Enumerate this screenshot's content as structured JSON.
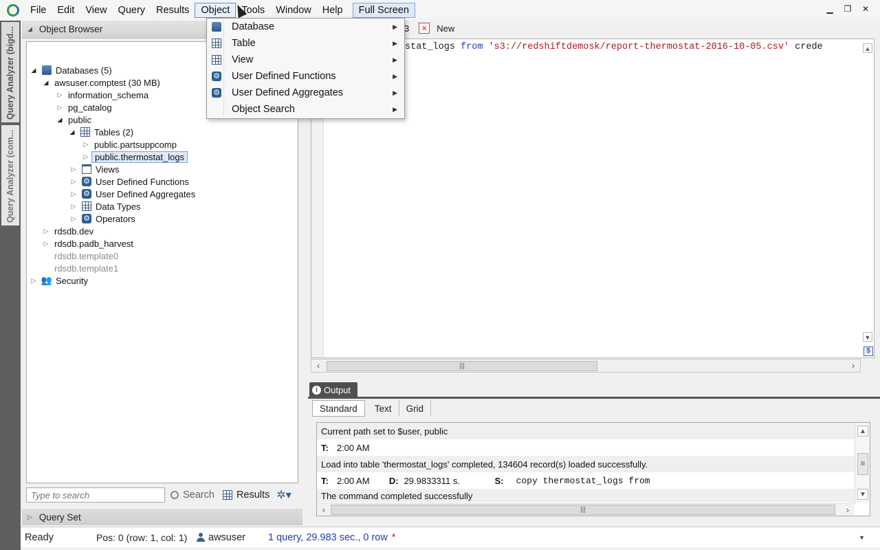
{
  "menubar": {
    "items": [
      "File",
      "Edit",
      "View",
      "Query",
      "Results",
      "Object",
      "Tools",
      "Window",
      "Help"
    ],
    "fullscreen_label": "Full Screen",
    "active_item": "Object"
  },
  "vertical_tabs": [
    "Query Analyzer (bigd...",
    "Query Analyzer (com..."
  ],
  "object_browser": {
    "title": "Object Browser",
    "tree": [
      {
        "label": "Databases (5)",
        "icon": "database-icon",
        "expanded": true
      },
      {
        "label": "awsuser.comptest (30 MB)",
        "expanded": true
      },
      {
        "label": "information_schema"
      },
      {
        "label": "pg_catalog"
      },
      {
        "label": "public",
        "expanded": true
      },
      {
        "label": "Tables (2)",
        "icon": "table-icon",
        "expanded": true
      },
      {
        "label": "public.partsuppcomp"
      },
      {
        "label": "public.thermostat_logs",
        "selected": true
      },
      {
        "label": "Views",
        "icon": "view-icon"
      },
      {
        "label": "User Defined Functions",
        "icon": "gear-icon"
      },
      {
        "label": "User Defined Aggregates",
        "icon": "gear-icon"
      },
      {
        "label": "Data Types",
        "icon": "table-icon"
      },
      {
        "label": "Operators",
        "icon": "gear-icon"
      },
      {
        "label": "rdsdb.dev"
      },
      {
        "label": "rdsdb.padb_harvest"
      },
      {
        "label": "rdsdb.template0"
      },
      {
        "label": "rdsdb.template1"
      },
      {
        "label": "Security",
        "icon": "users-icon"
      }
    ],
    "search_placeholder": "Type to search",
    "search_label": "Search",
    "results_label": "Results"
  },
  "query_set": {
    "title": "Query Set"
  },
  "object_menu": {
    "items": [
      {
        "label": "Database",
        "icon": "database-icon"
      },
      {
        "label": "Table",
        "icon": "table-icon"
      },
      {
        "label": "View",
        "icon": "view-icon"
      },
      {
        "label": "User Defined Functions",
        "icon": "gear-icon"
      },
      {
        "label": "User Defined Aggregates",
        "icon": "gear-icon"
      },
      {
        "label": "Object Search",
        "icon": ""
      }
    ]
  },
  "editor": {
    "tab_fragment": "3",
    "new_tab_label": "New",
    "code_table_fragment": "stat_logs",
    "code_from": "from",
    "code_string": "'s3://redshiftdemosk/report-thermostat-2016-10-05.csv'",
    "code_tail": "crede"
  },
  "output": {
    "panel_title": "Output",
    "tabs": [
      "Standard",
      "Text",
      "Grid"
    ],
    "active_tab": "Standard",
    "lines": {
      "l1": "Current path set to $user, public",
      "l2_t_label": "T:",
      "l2_time": "2:00 AM",
      "l3": "Load into table 'thermostat_logs' completed, 134604 record(s) loaded successfully.",
      "l4_t_label": "T:",
      "l4_time": "2:00 AM",
      "l4_d_label": "D:",
      "l4_duration": "29.9833311 s.",
      "l4_s_label": "S:",
      "l4_statement": "copy thermostat_logs from",
      "l5": "The command completed successfully"
    }
  },
  "statusbar": {
    "state": "Ready",
    "position": "Pos: 0 (row: 1, col: 1)",
    "user": "awsuser",
    "query_info": "1 query, 29.983 sec., 0 row",
    "modified_marker": "*"
  }
}
